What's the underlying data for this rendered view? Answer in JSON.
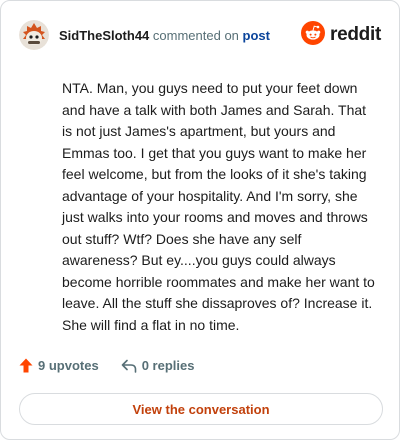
{
  "comment": {
    "author": "SidTheSloth44",
    "action_text": "commented on",
    "post_link": "post",
    "body": "NTA. Man, you guys need to put your feet down and have a talk with both James and Sarah. That is not just James's apartment, but yours and Emmas too. I get that you guys want to make her feel welcome, but from the looks of it she's taking advantage of your hospitality. And I'm sorry, she just walks into your rooms and moves and throws out stuff? Wtf? Does she have any self awareness? But ey....you guys could always become horrible roommates and make her want to leave. All the stuff she dissaproves of? Increase it. She will find a flat in no time."
  },
  "brand": {
    "wordmark": "reddit",
    "color": "#ff4500"
  },
  "stats": {
    "upvotes": "9 upvotes",
    "replies": "0 replies",
    "upvote_color": "#ff4500"
  },
  "cta": {
    "label": "View the conversation"
  },
  "icons": {
    "avatar": "snoo-avatar-icon",
    "brand": "reddit-logo-icon",
    "upvote": "upvote-arrow-icon",
    "reply": "reply-arrow-icon"
  }
}
